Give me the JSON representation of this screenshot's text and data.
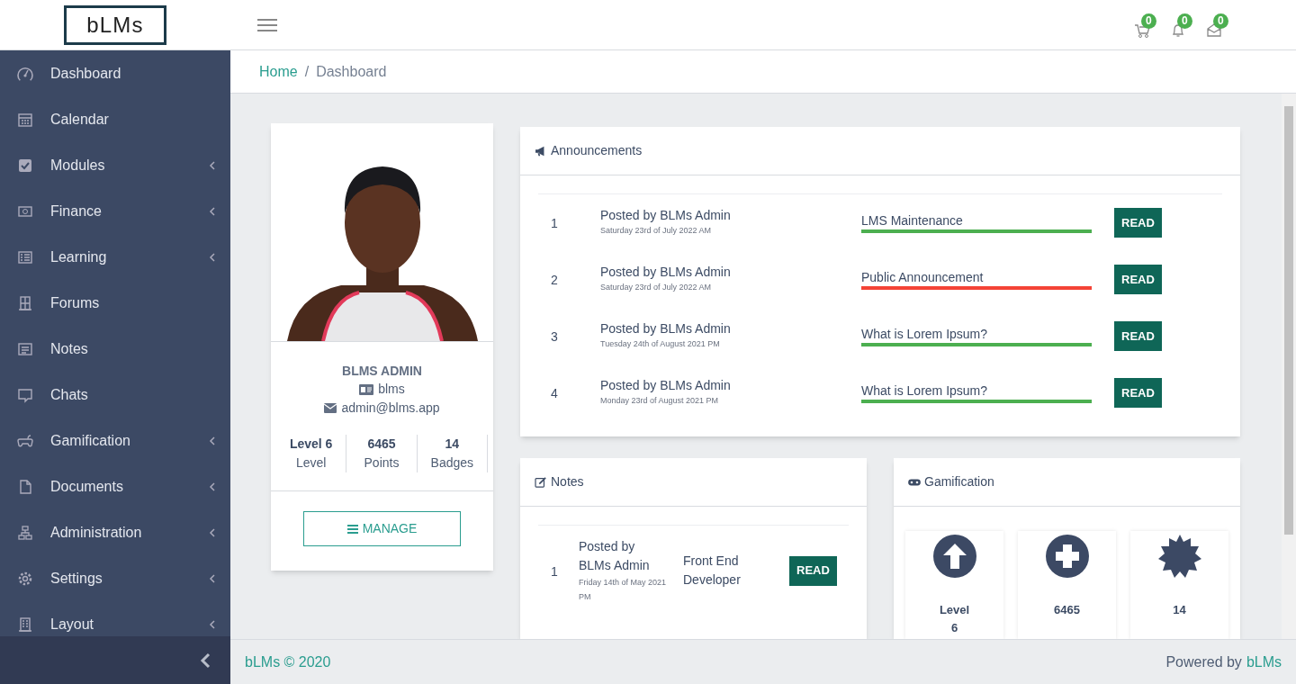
{
  "logo": {
    "text": "bLMs"
  },
  "header": {
    "badges": [
      {
        "kind": "cart",
        "count": "0"
      },
      {
        "kind": "bell",
        "count": "0"
      },
      {
        "kind": "mail",
        "count": "0"
      }
    ]
  },
  "sidebar": {
    "items": [
      {
        "label": "Dashboard",
        "expandable": false
      },
      {
        "label": "Calendar",
        "expandable": false
      },
      {
        "label": "Modules",
        "expandable": true
      },
      {
        "label": "Finance",
        "expandable": true
      },
      {
        "label": "Learning",
        "expandable": true
      },
      {
        "label": "Forums",
        "expandable": false
      },
      {
        "label": "Notes",
        "expandable": false
      },
      {
        "label": "Chats",
        "expandable": false
      },
      {
        "label": "Gamification",
        "expandable": true
      },
      {
        "label": "Documents",
        "expandable": true
      },
      {
        "label": "Administration",
        "expandable": true
      },
      {
        "label": "Settings",
        "expandable": true
      },
      {
        "label": "Layout",
        "expandable": true
      }
    ]
  },
  "breadcrumb": {
    "separator": "/",
    "items": [
      {
        "label": "Home",
        "current": false
      },
      {
        "label": "Dashboard",
        "current": true
      }
    ]
  },
  "profile": {
    "name": "BLMS ADMIN",
    "username": "blms",
    "email": "admin@blms.app",
    "stats": [
      {
        "value": "Level 6",
        "label": "Level"
      },
      {
        "value": "6465",
        "label": "Points"
      },
      {
        "value": "14",
        "label": "Badges"
      }
    ],
    "button": "MANAGE"
  },
  "announcements": {
    "title": "Announcements",
    "rows": [
      {
        "number": "1",
        "author": "Posted by BLMs Admin",
        "date": "Saturday 23rd of July 2022 AM",
        "title": "LMS Maintenance",
        "color": "#4caf50",
        "button": "READ"
      },
      {
        "number": "2",
        "author": "Posted by BLMs Admin",
        "date": "Saturday 23rd of July 2022 AM",
        "title": "Public Announcement",
        "color": "#f44336",
        "button": "READ"
      },
      {
        "number": "3",
        "author": "Posted by BLMs Admin",
        "date": "Tuesday 24th of August 2021 PM",
        "title": "What is Lorem Ipsum?",
        "color": "#4caf50",
        "button": "READ"
      },
      {
        "number": "4",
        "author": "Posted by BLMs Admin",
        "date": "Monday 23rd of August 2021 PM",
        "title": "What is Lorem Ipsum?",
        "color": "#4caf50",
        "button": "READ"
      }
    ]
  },
  "notes": {
    "title": "Notes",
    "rows": [
      {
        "number": "1",
        "author": "Posted by BLMs Admin",
        "date": "Friday 14th of May 2021 PM",
        "title": "Front End Developer",
        "button": "READ"
      }
    ]
  },
  "gamification": {
    "title": "Gamification",
    "tiles": [
      {
        "kind": "level",
        "value": "Level 6"
      },
      {
        "kind": "points",
        "value": "6465"
      },
      {
        "kind": "badges",
        "value": "14"
      }
    ]
  },
  "footer": {
    "copyright": "bLMs © 2020",
    "powered_by": "Powered by",
    "brand": "bLMs"
  }
}
